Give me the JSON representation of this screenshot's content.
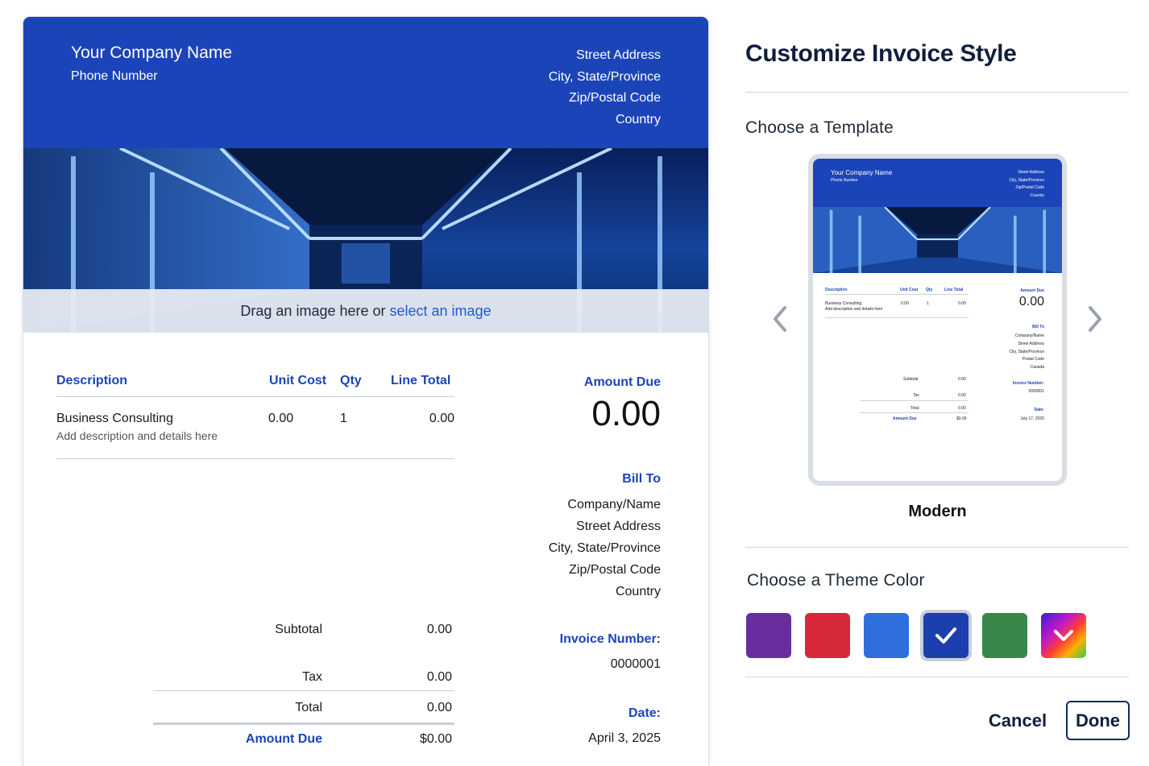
{
  "invoice": {
    "company_name": "Your Company Name",
    "phone": "Phone Number",
    "address": [
      "Street Address",
      "City, State/Province",
      "Zip/Postal Code",
      "Country"
    ],
    "drop_zone": {
      "text": "Drag an image here or",
      "link": "select an image"
    },
    "columns": {
      "description": "Description",
      "unit_cost": "Unit Cost",
      "qty": "Qty",
      "line_total": "Line Total"
    },
    "item": {
      "name": "Business Consulting",
      "details": "Add description and details here",
      "unit_cost": "0.00",
      "qty": "1",
      "line_total": "0.00"
    },
    "amount_due_label": "Amount Due",
    "amount_due_value": "0.00",
    "bill_to_label": "Bill To",
    "bill_to": [
      "Company/Name",
      "Street Address",
      "City, State/Province",
      "Zip/Postal Code",
      "Country"
    ],
    "invoice_number_label": "Invoice Number:",
    "invoice_number": "0000001",
    "date_label": "Date:",
    "date": "April 3, 2025",
    "totals": {
      "subtotal_label": "Subtotal",
      "subtotal": "0.00",
      "tax_label": "Tax",
      "tax": "0.00",
      "total_label": "Total",
      "total": "0.00",
      "amount_due_label": "Amount Due",
      "amount_due": "$0.00"
    }
  },
  "panel": {
    "title": "Customize Invoice Style",
    "choose_template": "Choose a Template",
    "template_name": "Modern",
    "choose_color": "Choose a Theme Color",
    "cancel": "Cancel",
    "done": "Done"
  },
  "thumbnail": {
    "company_name": "Your Company Name",
    "phone": "Phone Number",
    "address": [
      "Street Address",
      "City, State/Province",
      "Zip/Postal Code",
      "Country"
    ],
    "columns": {
      "description": "Description",
      "unit_cost": "Unit Cost",
      "qty": "Qty",
      "line_total": "Line Total"
    },
    "item_name": "Business Consulting",
    "item_details": "Add description and details here",
    "unit_cost": "0.00",
    "qty": "1",
    "line_total": "0.00",
    "amount_due_label": "Amount Due",
    "amount_due": "0.00",
    "bill_to_label": "Bill To",
    "bill_to": [
      "Company/Name",
      "Street Address",
      "City, State/Province",
      "Postal Code",
      "Canada"
    ],
    "invoice_number_label": "Invoice Number:",
    "invoice_number": "0000001",
    "date_label": "Date:",
    "date": "July 17, 2025",
    "subtotal_label": "Subtotal",
    "subtotal": "0.00",
    "tax_label": "Tax",
    "tax": "0.00",
    "total_label": "Total",
    "total": "0.00",
    "due_label": "Amount Due",
    "due": "$0.00"
  },
  "theme_colors": [
    {
      "name": "purple",
      "hex": "#6a2d9e"
    },
    {
      "name": "red",
      "hex": "#d62839"
    },
    {
      "name": "light-blue",
      "hex": "#2f6fdc"
    },
    {
      "name": "royal-blue",
      "hex": "#1c3fae",
      "selected": true
    },
    {
      "name": "green",
      "hex": "#3a874a"
    },
    {
      "name": "custom",
      "hex": "gradient"
    }
  ],
  "icons": {
    "prev": "chevron-left-icon",
    "next": "chevron-right-icon",
    "check": "checkmark-icon",
    "expand": "chevron-down-icon"
  }
}
